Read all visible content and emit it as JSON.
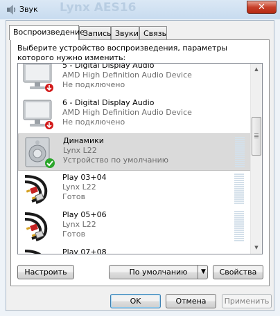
{
  "window": {
    "title": "Звук",
    "background_title": "Lynx AES16",
    "close_glyph": "✕"
  },
  "tabs": [
    {
      "label": "Воспроизведение",
      "active": true
    },
    {
      "label": "Запись",
      "active": false
    },
    {
      "label": "Звуки",
      "active": false
    },
    {
      "label": "Связь",
      "active": false
    }
  ],
  "instruction": "Выберите устройство воспроизведения, параметры которого нужно изменить:",
  "devices": [
    {
      "name": "5 - Digital Display Audio",
      "description": "AMD High Definition Audio Device",
      "status": "Не подключено",
      "icon": "monitor-icon",
      "badge": "disconnected-badge"
    },
    {
      "name": "6 - Digital Display Audio",
      "description": "AMD High Definition Audio Device",
      "status": "Не подключено",
      "icon": "monitor-icon",
      "badge": "disconnected-badge"
    },
    {
      "name": "Динамики",
      "description": "Lynx L22",
      "status": "Устройство по умолчанию",
      "icon": "speaker-icon",
      "badge": "default-check-badge",
      "selected": true
    },
    {
      "name": "Play 03+04",
      "description": "Lynx L22",
      "status": "Готов",
      "icon": "rca-cable-icon"
    },
    {
      "name": "Play 05+06",
      "description": "Lynx L22",
      "status": "Готов",
      "icon": "rca-cable-icon"
    },
    {
      "name": "Play 07+08",
      "description": "",
      "status": "",
      "icon": "rca-cable-icon"
    }
  ],
  "scrollbar": {
    "up_glyph": "▲",
    "down_glyph": "▼"
  },
  "buttons": {
    "configure": "Настроить",
    "set_default": "По умолчанию",
    "set_default_arrow": "▼",
    "properties": "Свойства",
    "ok": "OK",
    "cancel": "Отмена",
    "apply": "Применить"
  },
  "colors": {
    "close_button": "#c7402a",
    "selection": "#dadada",
    "badge_red": "#d21a1a",
    "badge_green": "#2aa52a"
  }
}
